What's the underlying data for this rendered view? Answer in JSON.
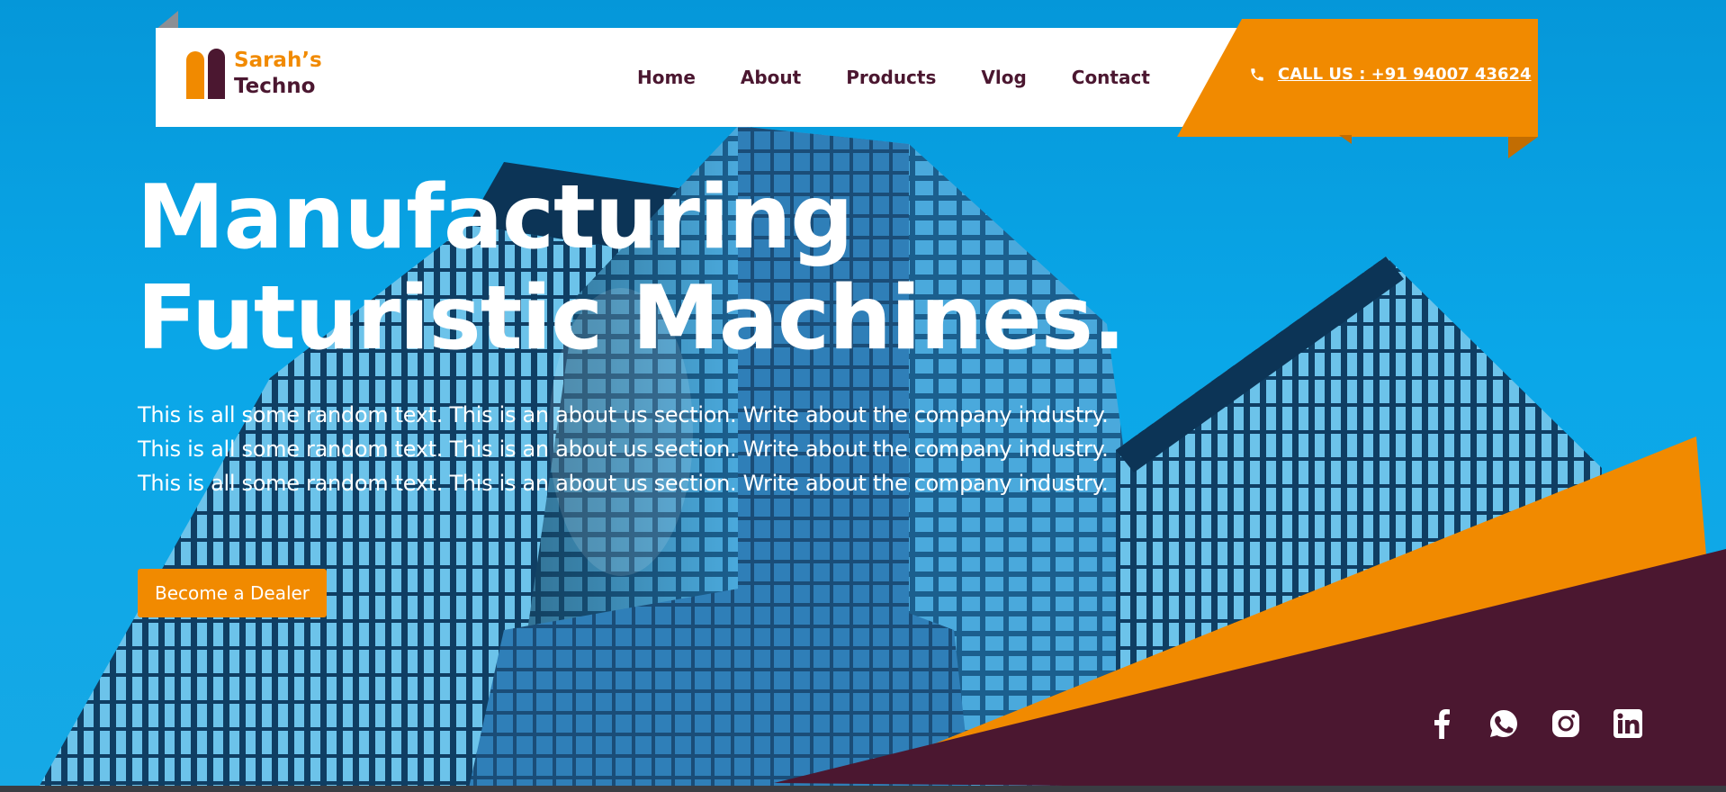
{
  "brand": {
    "line1": "Sarah’s",
    "line2": "Techno"
  },
  "nav": [
    {
      "label": "Home"
    },
    {
      "label": "About"
    },
    {
      "label": "Products"
    },
    {
      "label": "Vlog"
    },
    {
      "label": "Contact"
    }
  ],
  "call": {
    "label": "CALL US : +91 94007 43624"
  },
  "hero": {
    "headline_line1": "Manufacturing",
    "headline_line2": "Futuristic Machines.",
    "about": "This is all some random text. This is an about us section. Write about the company industry. This is all some random text. This is an about us section. Write about the company industry. This is all some random text. This is an about us section. Write about the company industry.",
    "cta_label": "Become a Dealer"
  },
  "socials": [
    {
      "icon": "facebook-icon"
    },
    {
      "icon": "whatsapp-icon"
    },
    {
      "icon": "instagram-icon"
    },
    {
      "icon": "linkedin-icon"
    }
  ],
  "colors": {
    "accent": "#f18a00",
    "brand_dark": "#4b1730",
    "sky": "#0aa7e8",
    "header_bg": "#ffffff"
  }
}
